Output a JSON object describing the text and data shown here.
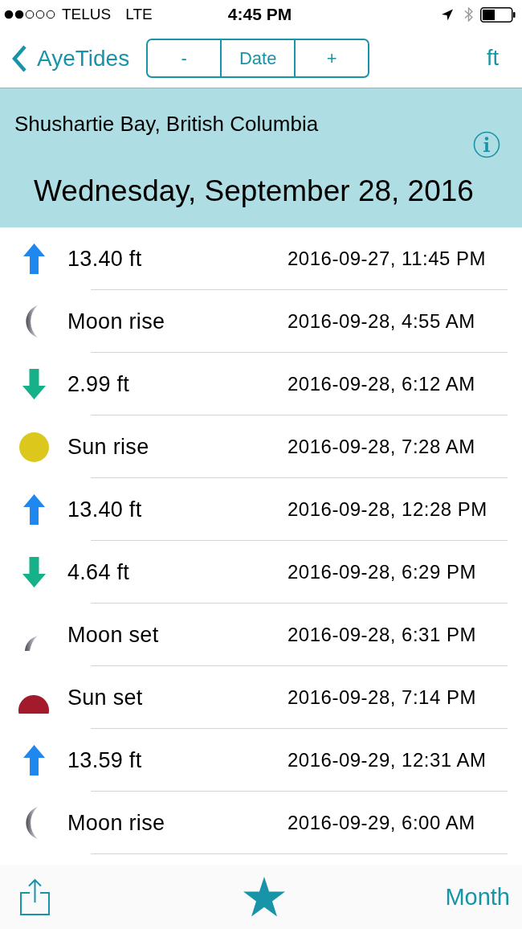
{
  "status_bar": {
    "carrier": "TELUS",
    "network": "LTE",
    "time": "4:45 PM"
  },
  "nav_bar": {
    "back_label": "AyeTides",
    "segments": [
      "-",
      "Date",
      "+"
    ],
    "unit": "ft"
  },
  "header": {
    "location": "Shushartie Bay, British Columbia",
    "date": "Wednesday, September 28, 2016"
  },
  "events": [
    {
      "kind": "high",
      "label": "13.40 ft",
      "time": "2016-09-27, 11:45 PM"
    },
    {
      "kind": "moonrise",
      "label": "Moon rise",
      "time": "2016-09-28, 4:55 AM"
    },
    {
      "kind": "low",
      "label": "2.99 ft",
      "time": "2016-09-28, 6:12 AM"
    },
    {
      "kind": "sunrise",
      "label": "Sun rise",
      "time": "2016-09-28, 7:28 AM"
    },
    {
      "kind": "high",
      "label": "13.40 ft",
      "time": "2016-09-28, 12:28 PM"
    },
    {
      "kind": "low",
      "label": "4.64 ft",
      "time": "2016-09-28, 6:29 PM"
    },
    {
      "kind": "moonset",
      "label": "Moon set",
      "time": "2016-09-28, 6:31 PM"
    },
    {
      "kind": "sunset",
      "label": "Sun set",
      "time": "2016-09-28, 7:14 PM"
    },
    {
      "kind": "high",
      "label": "13.59 ft",
      "time": "2016-09-29, 12:31 AM"
    },
    {
      "kind": "moonrise",
      "label": "Moon rise",
      "time": "2016-09-29, 6:00 AM"
    }
  ],
  "toolbar": {
    "right_label": "Month"
  }
}
